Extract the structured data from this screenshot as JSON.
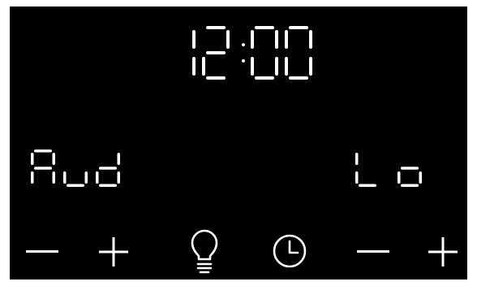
{
  "display": {
    "time": "12:00",
    "left_mode": "Aud",
    "right_level": "Lo"
  },
  "controls": {
    "left_minus": "−",
    "left_plus": "+",
    "light_icon": "lightbulb-icon",
    "timer_icon": "clock-icon",
    "right_minus": "−",
    "right_plus": "+"
  },
  "colors": {
    "background": "#000000",
    "segments": "#ffffff"
  }
}
